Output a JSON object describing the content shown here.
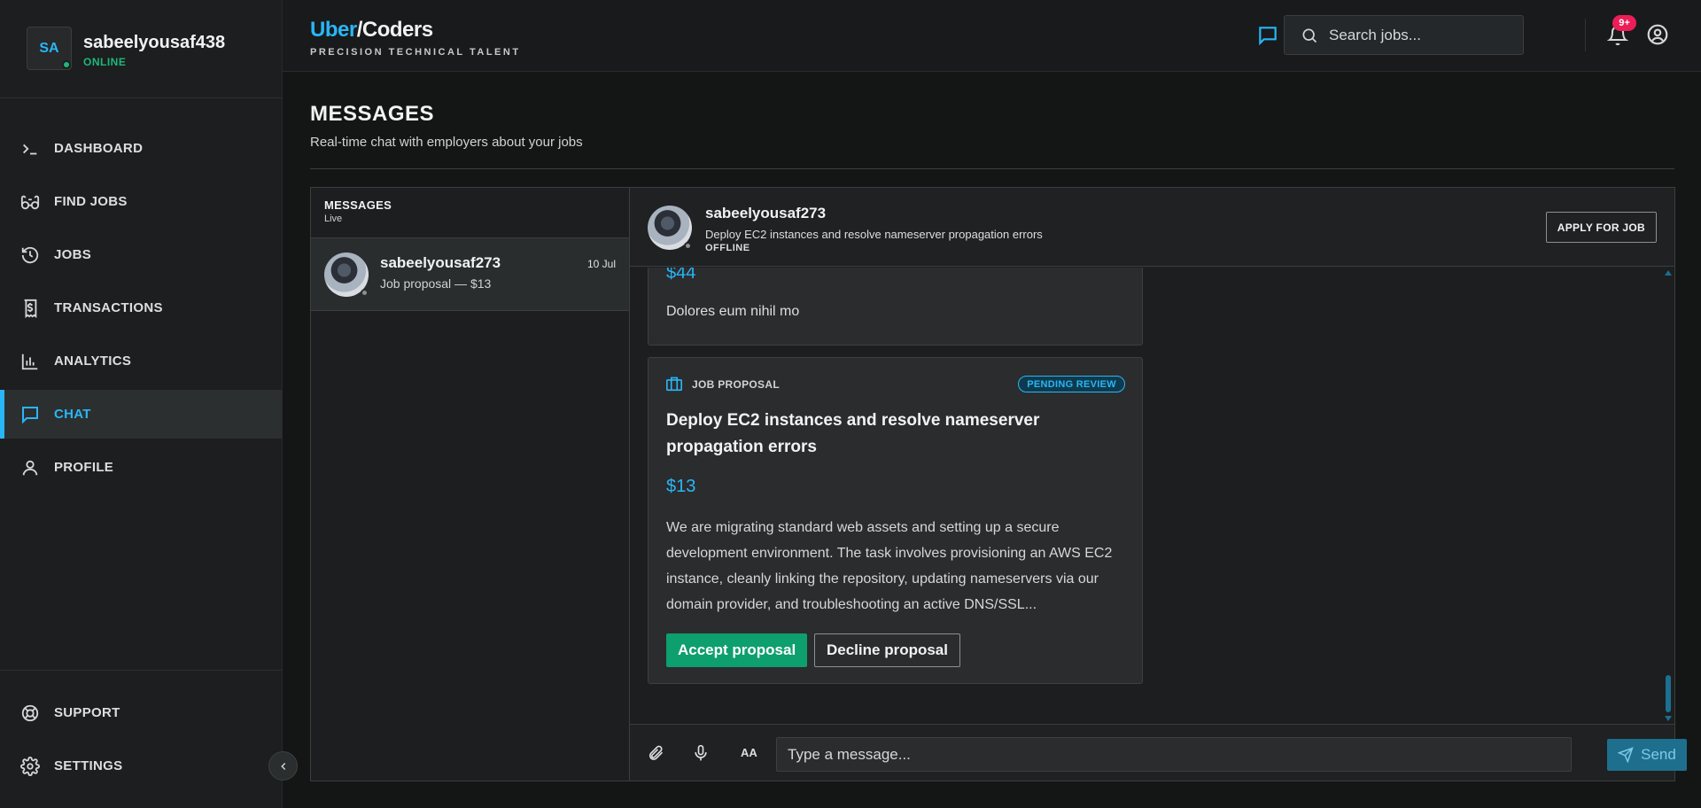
{
  "user": {
    "initials": "SA",
    "name": "sabeelyousaf438",
    "status": "ONLINE"
  },
  "nav": {
    "items": [
      {
        "label": "DASHBOARD",
        "icon": "terminal-icon"
      },
      {
        "label": "FIND JOBS",
        "icon": "binoculars-icon"
      },
      {
        "label": "JOBS",
        "icon": "history-icon"
      },
      {
        "label": "TRANSACTIONS",
        "icon": "receipt-icon"
      },
      {
        "label": "ANALYTICS",
        "icon": "bar-chart-icon"
      },
      {
        "label": "CHAT",
        "icon": "chat-icon",
        "active": true
      },
      {
        "label": "PROFILE",
        "icon": "user-icon"
      }
    ],
    "bottom": [
      {
        "label": "SUPPORT",
        "icon": "lifebuoy-icon"
      },
      {
        "label": "SETTINGS",
        "icon": "gear-icon"
      }
    ]
  },
  "topbar": {
    "logo_part1": "Uber",
    "logo_part2": "/Coders",
    "tagline": "PRECISION TECHNICAL TALENT",
    "search_placeholder": "Search jobs...",
    "notification_badge": "9+"
  },
  "page": {
    "title": "MESSAGES",
    "subtitle": "Real-time chat with employers about your jobs"
  },
  "conversations": {
    "header": "MESSAGES",
    "subheader": "Live",
    "items": [
      {
        "name": "sabeelyousaf273",
        "preview": "Job proposal — $13",
        "date": "10 Jul"
      }
    ]
  },
  "chat": {
    "name": "sabeelyousaf273",
    "job": "Deploy EC2 instances and resolve nameserver propagation errors",
    "status": "OFFLINE",
    "apply_label": "APPLY FOR JOB",
    "messages": [
      {
        "amount": "$44",
        "description": "Dolores eum nihil mo"
      },
      {
        "tag": "JOB PROPOSAL",
        "status": "PENDING REVIEW",
        "title": "Deploy EC2 instances and resolve nameserver propagation errors",
        "amount": "$13",
        "body": "We are migrating standard web assets and setting up a secure development environment. The task involves provisioning an AWS EC2 instance, cleanly linking the repository, updating nameservers via our domain provider, and troubleshooting an active DNS/SSL...",
        "accept_label": "Accept proposal",
        "decline_label": "Decline proposal"
      }
    ],
    "composer": {
      "aa_label": "AA",
      "placeholder": "Type a message...",
      "send_label": "Send"
    }
  },
  "colors": {
    "accent": "#29b6f6",
    "online": "#1db87a",
    "accept": "#0e9f6e",
    "badge": "#ec1e57"
  }
}
